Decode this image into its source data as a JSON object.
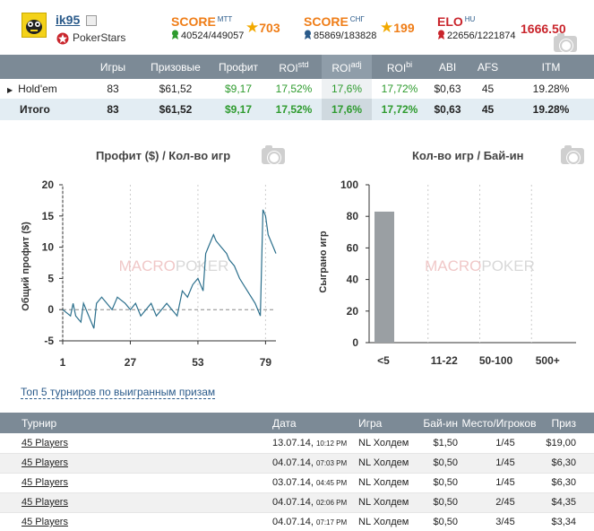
{
  "player": {
    "username": "ik95",
    "room": "PokerStars"
  },
  "scores": {
    "mtt": {
      "label": "SCORE",
      "sup": "MTT",
      "rank": "40524/449057",
      "value": "703"
    },
    "cis": {
      "label": "SCORE",
      "sup": "СНГ",
      "rank": "85869/183828",
      "value": "199"
    },
    "elo": {
      "label": "ELO",
      "sup": "HU",
      "rank": "22656/1221874",
      "value": "1666.50"
    }
  },
  "stats": {
    "headers": [
      "Игры",
      "Призовые",
      "Профит",
      "ROI",
      "ROI",
      "ROI",
      "ABI",
      "AFS",
      "ITM"
    ],
    "roi_sups": [
      "std",
      "adj",
      "bi"
    ],
    "rows": [
      {
        "name": "Hold'em",
        "games": "83",
        "prize": "$61,52",
        "profit": "$9,17",
        "roi_std": "17,52%",
        "roi_adj": "17,6%",
        "roi_bi": "17,72%",
        "abi": "$0,63",
        "afs": "45",
        "itm": "19.28%"
      },
      {
        "name": "Итого",
        "games": "83",
        "prize": "$61,52",
        "profit": "$9,17",
        "roi_std": "17,52%",
        "roi_adj": "17,6%",
        "roi_bi": "17,72%",
        "abi": "$0,63",
        "afs": "45",
        "itm": "19.28%"
      }
    ]
  },
  "charts": {
    "watermark_a": "MACRO",
    "watermark_b": "POKER"
  },
  "chart_data": [
    {
      "type": "line",
      "title": "Профит ($) / Кол-во игр",
      "ylabel": "Общий профит ($)",
      "xlabel": "",
      "xlim": [
        1,
        83
      ],
      "ylim": [
        -5,
        20
      ],
      "xticks": [
        "1",
        "27",
        "53",
        "79"
      ],
      "yticks": [
        "-5",
        "0",
        "5",
        "10",
        "15",
        "20"
      ],
      "x": [
        1,
        4,
        5,
        6,
        8,
        9,
        13,
        14,
        16,
        18,
        20,
        22,
        25,
        27,
        29,
        31,
        33,
        35,
        37,
        39,
        41,
        43,
        45,
        47,
        49,
        51,
        53,
        55,
        56,
        57,
        58,
        59,
        60,
        62,
        64,
        65,
        67,
        69,
        72,
        75,
        77,
        78,
        79,
        80,
        81,
        82,
        83
      ],
      "y": [
        0,
        -1,
        1,
        -1,
        -2,
        1,
        -3,
        1,
        2,
        1,
        0,
        2,
        1,
        0,
        1,
        -1,
        0,
        1,
        -1,
        0,
        1,
        0,
        -1,
        3,
        2,
        4,
        5,
        3,
        9,
        10,
        11,
        12,
        11,
        10,
        9,
        8,
        7,
        5,
        3,
        1,
        -1,
        16,
        15,
        12,
        11,
        10,
        9
      ]
    },
    {
      "type": "bar",
      "title": "Кол-во игр / Бай-ин",
      "ylabel": "Сыграно игр",
      "categories": [
        "<5",
        "11-22",
        "50-100",
        "500+"
      ],
      "values": [
        83,
        0,
        0,
        0
      ],
      "ylim": [
        0,
        100
      ],
      "yticks": [
        "0",
        "20",
        "40",
        "60",
        "80",
        "100"
      ]
    }
  ],
  "top5": {
    "link": "Топ 5 турниров по выигранным призам",
    "headers": [
      "Турнир",
      "Дата",
      "Игра",
      "Бай-ин",
      "Место/Игроков",
      "Приз"
    ],
    "rows": [
      {
        "name": "45 Players",
        "date": "13.07.14,",
        "time": "10:12 PM",
        "game": "NL Холдем",
        "buyin": "$1,50",
        "place": "1/45",
        "prize": "$19,00"
      },
      {
        "name": "45 Players",
        "date": "04.07.14,",
        "time": "07:03 PM",
        "game": "NL Холдем",
        "buyin": "$0,50",
        "place": "1/45",
        "prize": "$6,30"
      },
      {
        "name": "45 Players",
        "date": "03.07.14,",
        "time": "04:45 PM",
        "game": "NL Холдем",
        "buyin": "$0,50",
        "place": "1/45",
        "prize": "$6,30"
      },
      {
        "name": "45 Players",
        "date": "04.07.14,",
        "time": "02:06 PM",
        "game": "NL Холдем",
        "buyin": "$0,50",
        "place": "2/45",
        "prize": "$4,35"
      },
      {
        "name": "45 Players",
        "date": "04.07.14,",
        "time": "07:17 PM",
        "game": "NL Холдем",
        "buyin": "$0,50",
        "place": "3/45",
        "prize": "$3,34"
      }
    ]
  }
}
